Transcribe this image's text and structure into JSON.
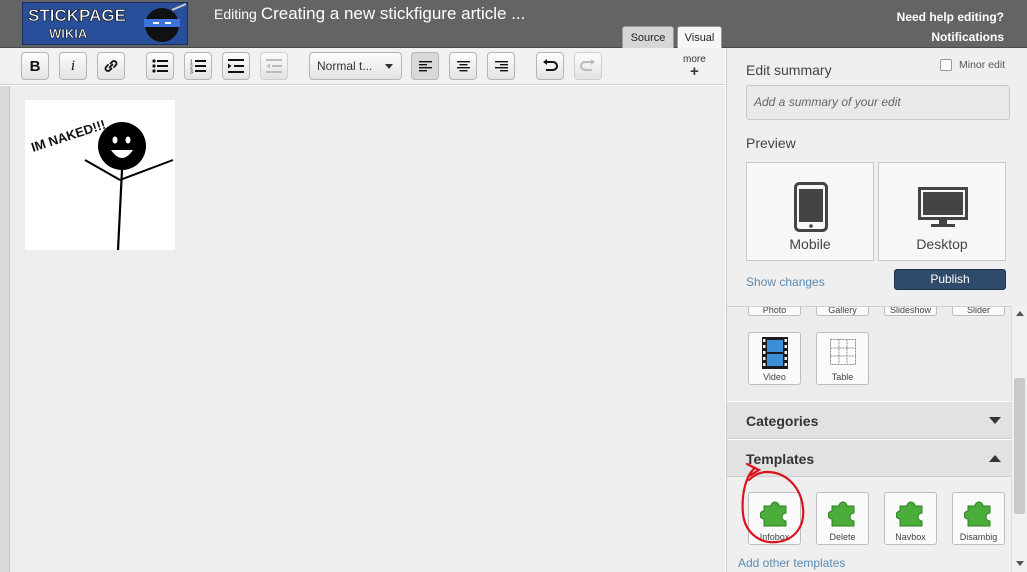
{
  "header": {
    "logo_line1": "STICKPAGE",
    "logo_line2": "WIKIA",
    "editing_label": "Editing",
    "title": "Creating a new stickfigure article ...",
    "help_link": "Need help editing?",
    "notifications": "Notifications",
    "tabs": [
      {
        "label": "Source",
        "active": false
      },
      {
        "label": "Visual",
        "active": true
      }
    ]
  },
  "toolbar": {
    "bold": "B",
    "italic": "i",
    "format_select": "Normal t...",
    "more_label": "more",
    "more_plus": "+",
    "buttons": [
      "bold",
      "italic",
      "link",
      "bullet-list",
      "numbered-list",
      "indent",
      "outdent",
      "format",
      "align-left",
      "align-center",
      "align-right",
      "undo",
      "redo",
      "more"
    ]
  },
  "content": {
    "image_caption_text": "IM NAKED!!!"
  },
  "sidebar": {
    "edit_summary_label": "Edit summary",
    "minor_edit_label": "Minor edit",
    "minor_edit_checked": false,
    "summary_placeholder": "Add a summary of your edit",
    "preview_label": "Preview",
    "preview_mobile": "Mobile",
    "preview_desktop": "Desktop",
    "show_changes": "Show changes",
    "publish": "Publish",
    "media_cut_labels": [
      "Photo",
      "Gallery",
      "Slideshow",
      "Slider"
    ],
    "media_items": [
      {
        "label": "Video",
        "icon": "film-icon"
      },
      {
        "label": "Table",
        "icon": "table-icon"
      }
    ],
    "categories_label": "Categories",
    "templates_label": "Templates",
    "templates": [
      "Infobox",
      "Delete",
      "Navbox",
      "Disambig"
    ],
    "add_other_templates": "Add other templates"
  },
  "colors": {
    "header_bg": "#636466",
    "publish_bg": "#2f4a6b",
    "link": "#5b8ab0",
    "template_icon_green": "#4cae3a",
    "annotation_red": "#d9131d"
  }
}
